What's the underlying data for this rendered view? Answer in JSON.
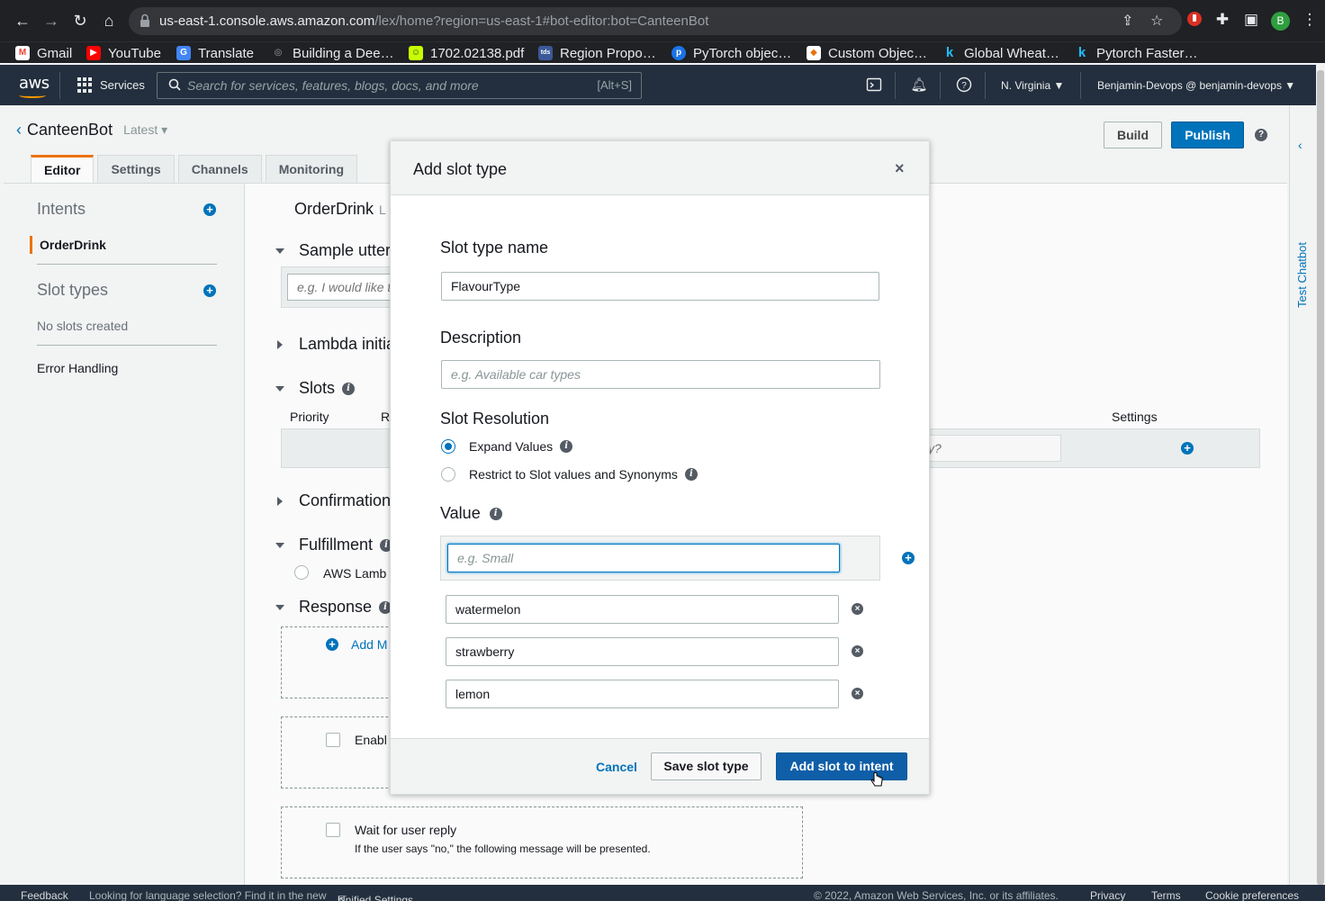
{
  "browser": {
    "url_host": "us-east-1.console.aws.amazon.com",
    "url_path": "/lex/home?region=us-east-1#bot-editor:bot=CanteenBot",
    "profile_initial": "B",
    "bookmarks": [
      {
        "label": "Gmail",
        "icon": "gmail-icon",
        "color": "#ea4335"
      },
      {
        "label": "YouTube",
        "icon": "youtube-icon",
        "color": "#ff0000"
      },
      {
        "label": "Translate",
        "icon": "translate-icon",
        "color": "#4285f4"
      },
      {
        "label": "Building a Dee…",
        "icon": "site-icon",
        "color": "#9aa0a6"
      },
      {
        "label": "1702.02138.pdf",
        "icon": "pdf-icon",
        "color": "#7cb342"
      },
      {
        "label": "Region Propo…",
        "icon": "tds-icon",
        "color": "#3b5998"
      },
      {
        "label": "PyTorch objec…",
        "icon": "p-icon",
        "color": "#1a73e8"
      },
      {
        "label": "Custom Objec…",
        "icon": "custom-icon",
        "color": "#e8710a"
      },
      {
        "label": "Global Wheat…",
        "icon": "kaggle-icon",
        "color": "#20beff"
      },
      {
        "label": "Pytorch Faster…",
        "icon": "kaggle-icon",
        "color": "#20beff"
      }
    ]
  },
  "aws_header": {
    "logo": "aws",
    "services_label": "Services",
    "search_placeholder": "Search for services, features, blogs, docs, and more",
    "search_shortcut": "[Alt+S]",
    "region": "N. Virginia",
    "account": "Benjamin-Devops @ benjamin-devops"
  },
  "bot": {
    "name": "CanteenBot",
    "version": "Latest",
    "build_label": "Build",
    "publish_label": "Publish",
    "help": "?"
  },
  "tabs": [
    "Editor",
    "Settings",
    "Channels",
    "Monitoring"
  ],
  "right_rail": {
    "label": "Test Chatbot"
  },
  "left_panel": {
    "intents_heading": "Intents",
    "intent_active": "OrderDrink",
    "slot_types_heading": "Slot types",
    "no_slots": "No slots created",
    "error_handling": "Error Handling"
  },
  "main": {
    "intent_title": "OrderDrink",
    "intent_tag": "L",
    "sample_utterances": "Sample utter",
    "utterance_placeholder": "e.g. I would like t",
    "lambda": "Lambda initia",
    "slots": "Slots",
    "col_priority": "Priority",
    "col_r": "R",
    "col_settings": "Settings",
    "slot_prompt_placeholder": "ity?",
    "confirmation": "Confirmation",
    "fulfillment": "Fulfillment",
    "aws_lambda": "AWS Lamb",
    "response": "Response",
    "add_message": "Add M",
    "enable": "Enabl",
    "wait_for_reply": "Wait for user reply",
    "wait_note": "If the user says \"no,\" the following message will be presented."
  },
  "modal": {
    "title": "Add slot type",
    "close": "×",
    "slot_type_name_label": "Slot type name",
    "slot_type_name_value": "FlavourType",
    "description_label": "Description",
    "description_placeholder": "e.g. Available car types",
    "slot_resolution_label": "Slot Resolution",
    "resolution_options": [
      {
        "label": "Expand Values",
        "selected": true
      },
      {
        "label": "Restrict to Slot values and Synonyms",
        "selected": false
      }
    ],
    "value_label": "Value",
    "value_placeholder": "e.g. Small",
    "values": [
      "watermelon",
      "strawberry",
      "lemon"
    ],
    "cancel": "Cancel",
    "save": "Save slot type",
    "add": "Add slot to intent"
  },
  "footer": {
    "feedback": "Feedback",
    "lang_note": "Looking for language selection? Find it in the new",
    "unified_settings": "Unified Settings",
    "copyright": "© 2022, Amazon Web Services, Inc. or its affiliates.",
    "privacy": "Privacy",
    "terms": "Terms",
    "cookies": "Cookie preferences"
  }
}
